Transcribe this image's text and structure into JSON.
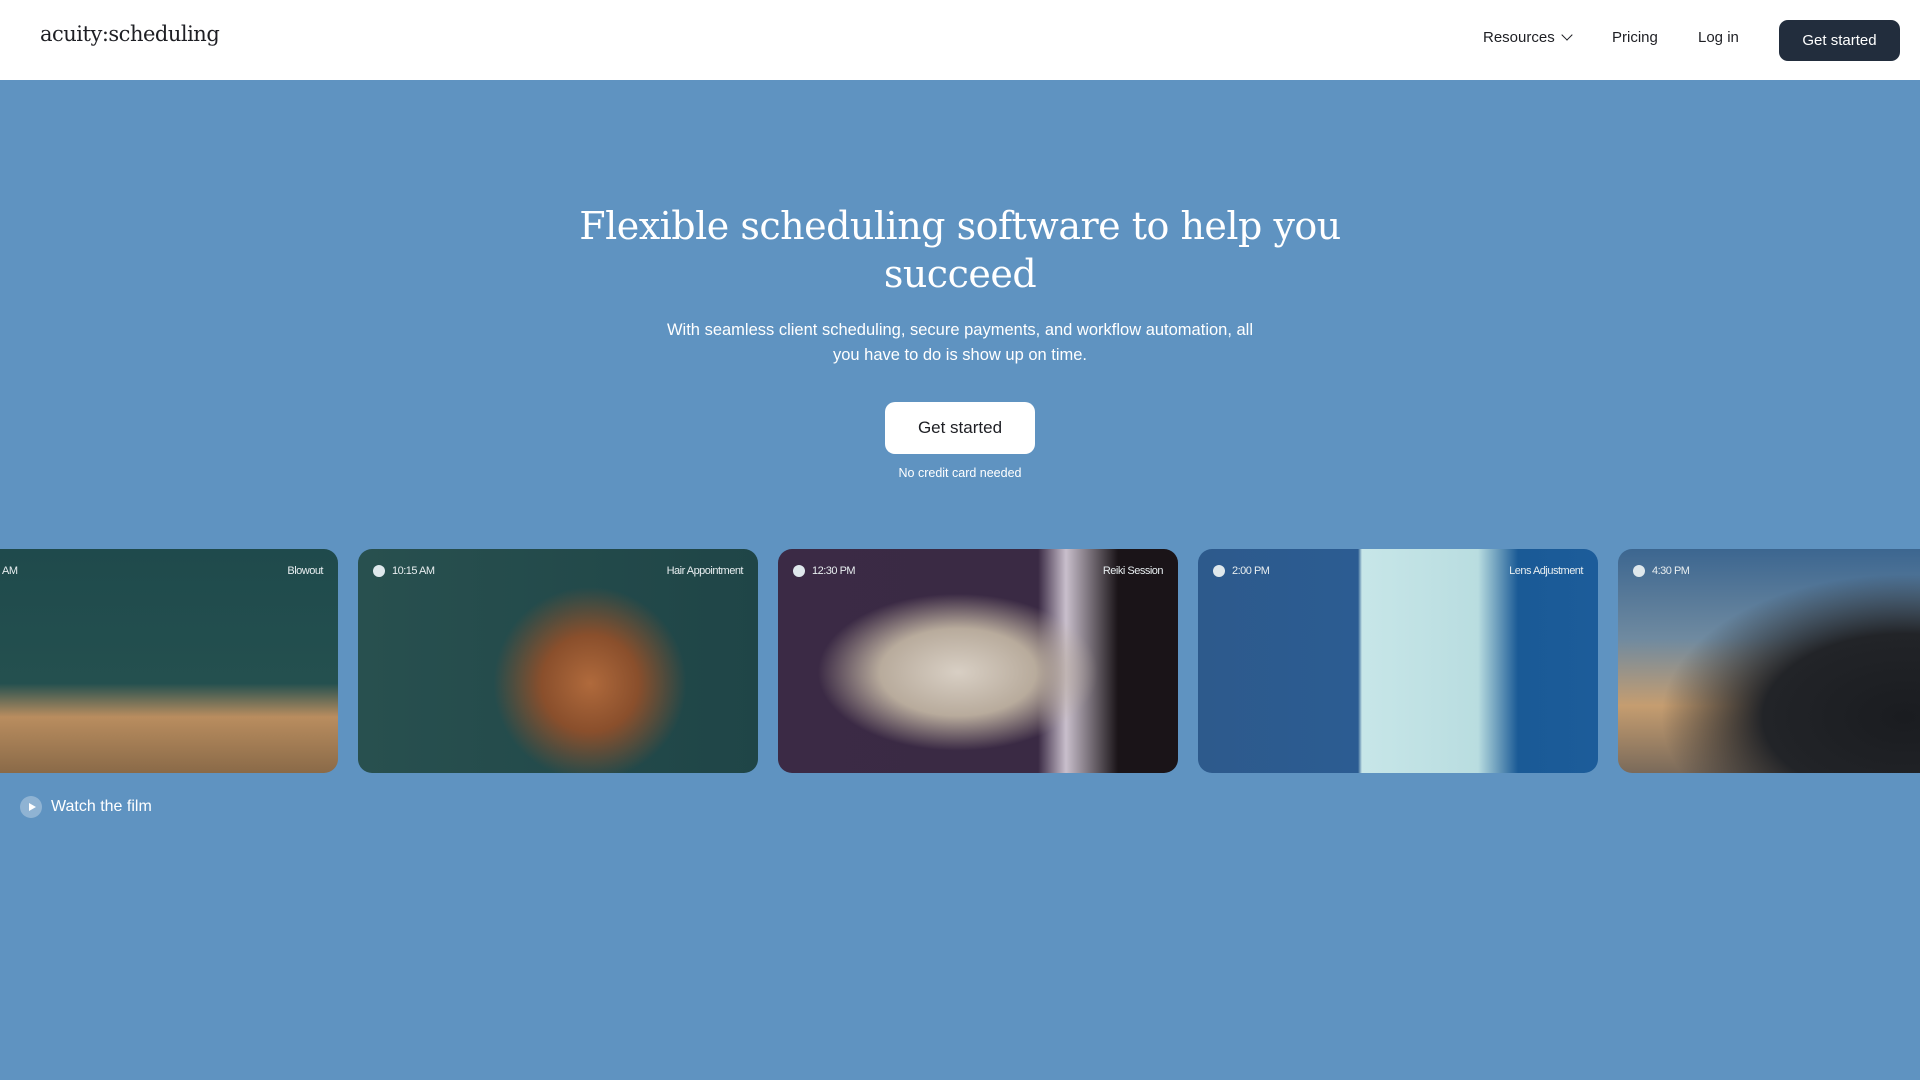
{
  "header": {
    "logo": "acuity:scheduling",
    "nav": [
      "Resources",
      "Pricing",
      "Log in"
    ],
    "cta": "Get started"
  },
  "hero": {
    "title": "Flexible scheduling software to help you succeed",
    "subtitle": "With seamless client scheduling, secure payments, and workflow automation, all you have to do is show up on time.",
    "button": "Get started",
    "note": "No credit card needed"
  },
  "cards": [
    {
      "time": "AM",
      "label": "Blowout"
    },
    {
      "time": "10:15 AM",
      "label": "Hair Appointment"
    },
    {
      "time": "12:30 PM",
      "label": "Reiki Session"
    },
    {
      "time": "2:00 PM",
      "label": "Lens Adjustment"
    },
    {
      "time": "4:30 PM",
      "label": ""
    }
  ],
  "watch": "Watch the film",
  "colors": {
    "background": "#5f93c1",
    "cta": "#222d3d"
  }
}
